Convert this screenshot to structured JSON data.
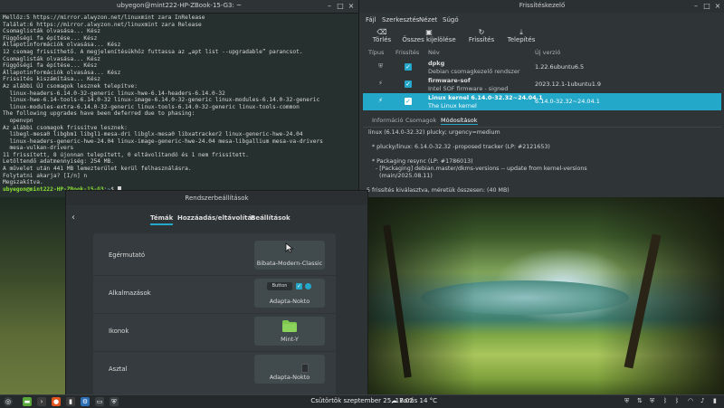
{
  "terminal": {
    "title": "ubyegon@mint222-HP-ZBook-15-G3: ~",
    "lines": [
      "Mellőz:5 https://mirror.alwyzon.net/linuxmint zara InRelease",
      "Találat:6 https://mirror.alwyzon.net/linuxmint zara Release",
      "Csomaglisták olvasása... Kész",
      "Függőségi fa építése... Kész",
      "Állapotinformációk olvasása... Kész",
      "12 csomag frissíthető. A megjelenítésükhöz futtassa az „apt list --upgradable” parancsot.",
      "Csomaglisták olvasása... Kész",
      "Függőségi fa építése... Kész",
      "Állapotinformációk olvasása... Kész",
      "Frissítés kiszámítása... Kész",
      "Az alábbi ÚJ csomagok lesznek telepítve:",
      "  linux-headers-6.14.0-32-generic linux-hwe-6.14-headers-6.14.0-32",
      "  linux-hwe-6.14-tools-6.14.0-32 linux-image-6.14.0-32-generic linux-modules-6.14.0-32-generic",
      "  linux-modules-extra-6.14.0-32-generic linux-tools-6.14.0-32-generic linux-tools-common",
      "The following upgrades have been deferred due to phasing:",
      "  openvpn",
      "Az alábbi csomagok frissítve lesznek:",
      "  libegl-mesa0 libgbm1 libgl1-mesa-dri libglx-mesa0 libxatracker2 linux-generic-hwe-24.04",
      "  linux-headers-generic-hwe-24.04 linux-image-generic-hwe-24.04 mesa-libgallium mesa-va-drivers",
      "  mesa-vulkan-drivers",
      "11 frissített, 8 újonnan telepített, 0 eltávolítandó és 1 nem frissített.",
      "Letöltendő adatmennyiség: 254 MB.",
      "A művelet után 441 MB lemezterület kerül felhasználásra.",
      "Folytatni akarja? [I/n] n",
      "Megszakítva."
    ],
    "prompt_user": "ubyegon@mint222-HP-ZBook-15-G3",
    "prompt_path": "~",
    "prompt_symbol": "$"
  },
  "update_manager": {
    "title": "Frissítéskezelő",
    "menu": [
      "Fájl",
      "Szerkesztés",
      "Nézet",
      "Súgó"
    ],
    "toolbar": {
      "clear": "Törlés",
      "select_all": "Összes kijelölése",
      "refresh": "Frissítés",
      "install": "Telepítés"
    },
    "columns": {
      "type": "Típus",
      "upgrade": "Frissítés",
      "name": "Név",
      "new_version": "Új verzió"
    },
    "rows": [
      {
        "name": "dpkg",
        "desc": "Debian csomagkezelő rendszer",
        "version": "1.22.6ubuntu6.5",
        "selected": false
      },
      {
        "name": "firmware-sof",
        "desc": "Intel SOF firmware - signed",
        "version": "2023.12.1-1ubuntu1.9",
        "selected": false
      },
      {
        "name": "Linux kernel 6.14.0-32.32~24.04.1",
        "desc": "The Linux kernel",
        "version": "6.14.0-32.32~24.04.1",
        "selected": true
      }
    ],
    "tabs": [
      "Információ",
      "Csomagok",
      "Módosítások"
    ],
    "active_tab": "Módosítások",
    "changelog": [
      "linux (6.14.0-32.32) plucky; urgency=medium",
      "",
      "  * plucky/linux: 6.14.0-32.32 -proposed tracker (LP: #2121653)",
      "",
      "  * Packaging resync (LP: #1786013)",
      "    - [Packaging] debian.master/dkms-versions -- update from kernel-versions",
      "      (main/2025.08.11)"
    ],
    "status": "5 frissítés kiválasztva, méretük összesen: (40 MB)"
  },
  "settings": {
    "title": "Rendszerbeállítások",
    "tabs": [
      "Témák",
      "Hozzáadás/eltávolítás",
      "Beállítások"
    ],
    "active_tab": "Témák",
    "rows": [
      {
        "label": "Egérmutató",
        "value": "Bibata-Modern-Classic"
      },
      {
        "label": "Alkalmazások",
        "value": "Adapta-Nokto",
        "preview_button": "Button"
      },
      {
        "label": "Ikonok",
        "value": "Mint-Y"
      },
      {
        "label": "Asztal",
        "value": "Adapta-Nokto"
      }
    ]
  },
  "taskbar": {
    "clock": "Csütörtök szeptember 25, 17.02",
    "weather": "Borús 14 °C"
  },
  "colors": {
    "accent": "#23a8c9",
    "terminal_bg": "#26302f",
    "prompt_user": "#8ae234",
    "prompt_path": "#729fcf"
  }
}
